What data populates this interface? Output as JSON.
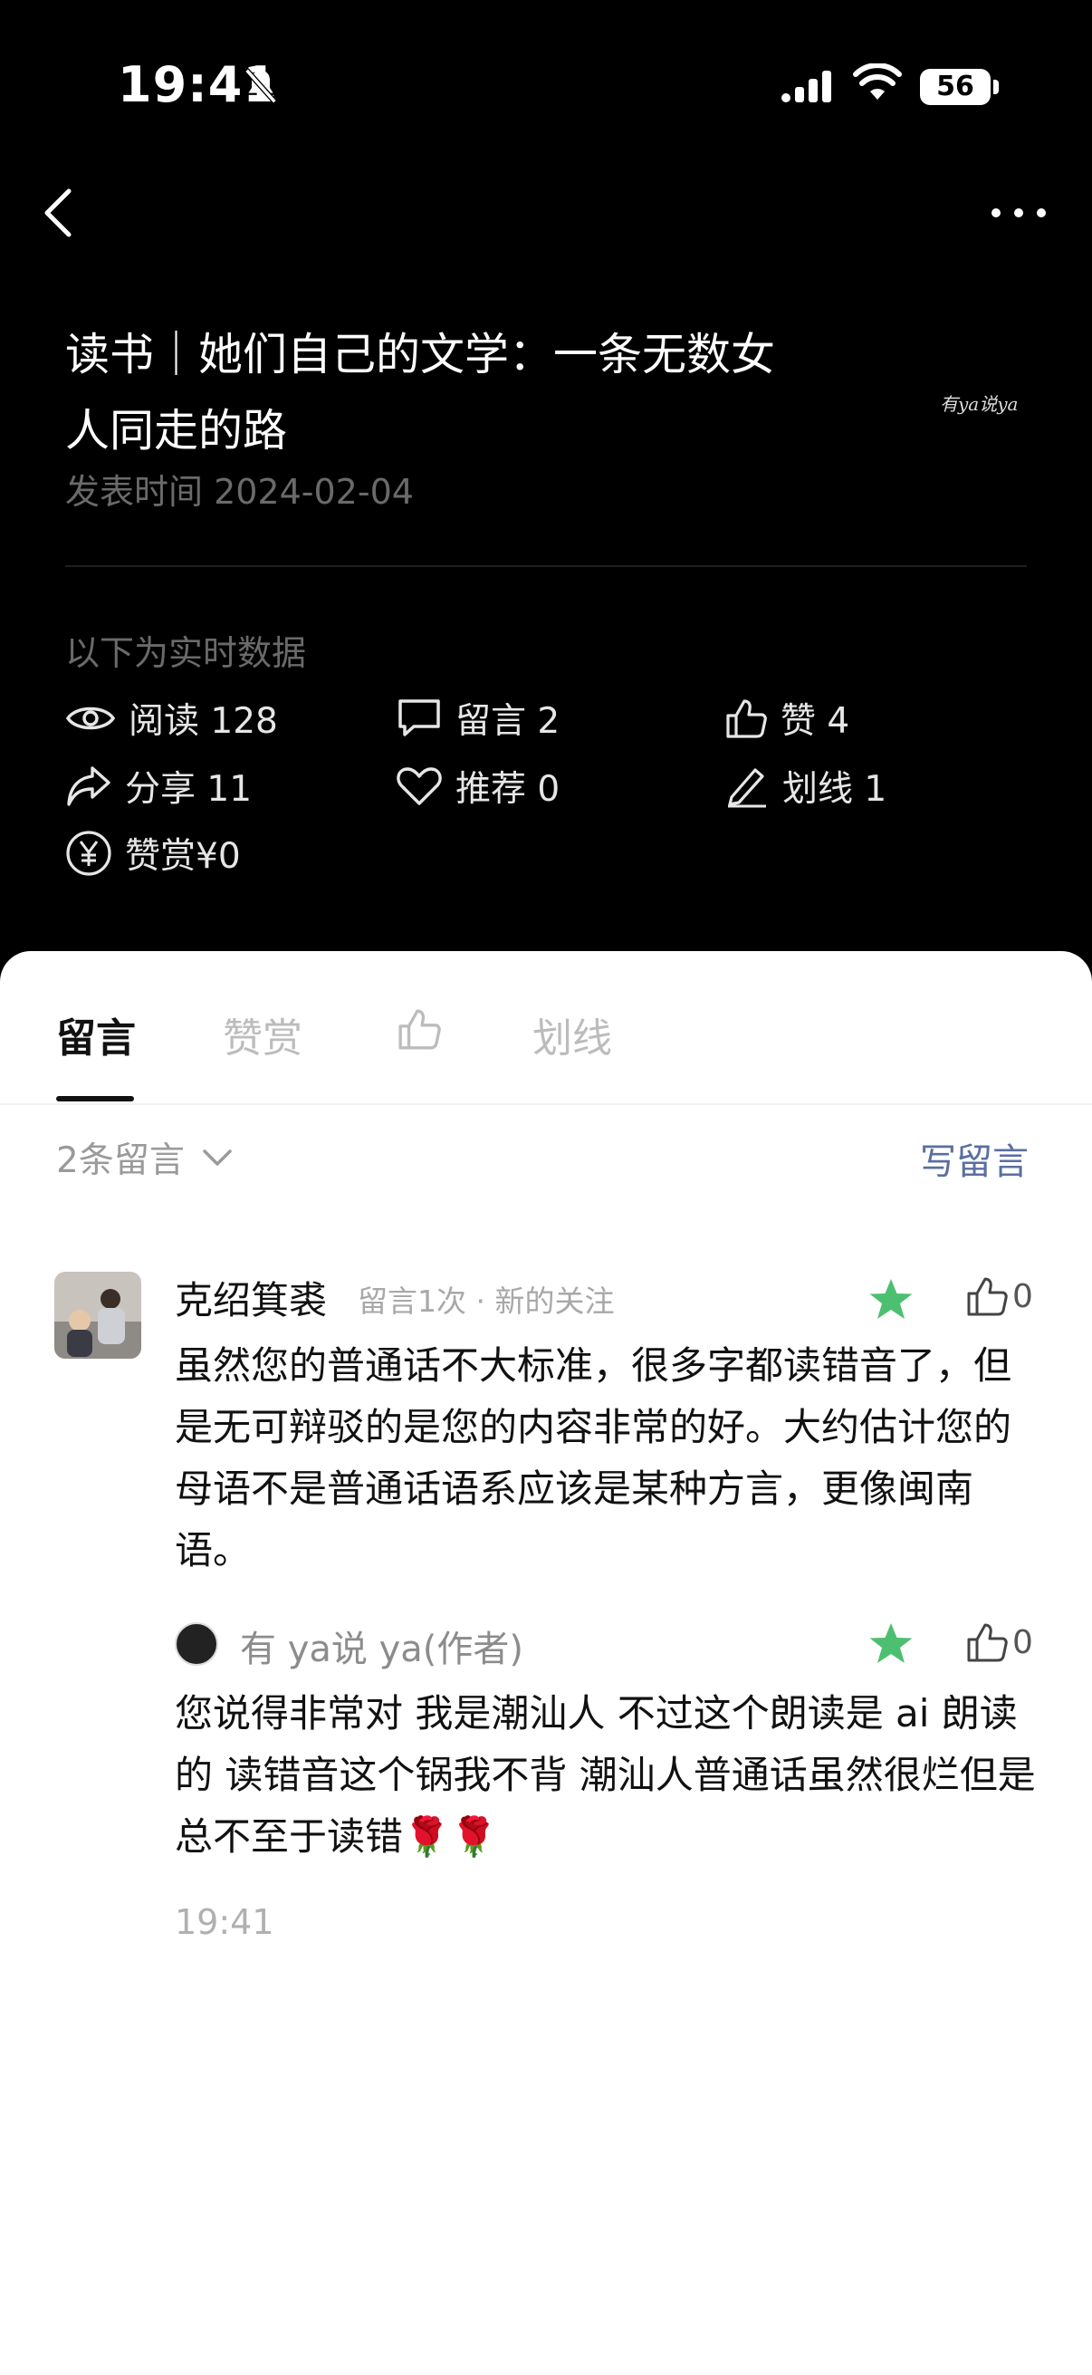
{
  "status_bar": {
    "time": "19:41",
    "battery": "56"
  },
  "article": {
    "title_line1": "读书｜她们自己的文学：一条无数女",
    "title_line2": "人同走的路",
    "signature": "有ya说ya",
    "published": "发表时间 2024-02-04"
  },
  "realtime_label": "以下为实时数据",
  "stats": {
    "read": "阅读 128",
    "comments": "留言 2",
    "likes": "赞 4",
    "shares": "分享 11",
    "recommend": "推荐 0",
    "underline": "划线 1",
    "reward": "赞赏¥0"
  },
  "tabs": {
    "comments": "留言",
    "reward": "赞赏",
    "underline": "划线"
  },
  "comments_header": {
    "count": "2条留言",
    "write": "写留言"
  },
  "comment": {
    "author": "克绍箕裘",
    "meta": "留言1次 · 新的关注",
    "likes": "0",
    "text": "虽然您的普通话不大标准，很多字都读错音了，但是无可辩驳的是您的内容非常的好。大约估计您的母语不是普通话语系应该是某种方言，更像闽南语。"
  },
  "reply": {
    "author": "有 ya说 ya(作者)",
    "likes": "0",
    "text": "您说得非常对 我是潮汕人 不过这个朗读是 ai 朗读的 读错音这个锅我不背 潮汕人普通话虽然很烂但是总不至于读错🌹🌹",
    "time": "19:41"
  },
  "colors": {
    "star": "#4cc070",
    "link": "#5a6fa0",
    "background": "#000000",
    "sheet": "#ffffff"
  }
}
